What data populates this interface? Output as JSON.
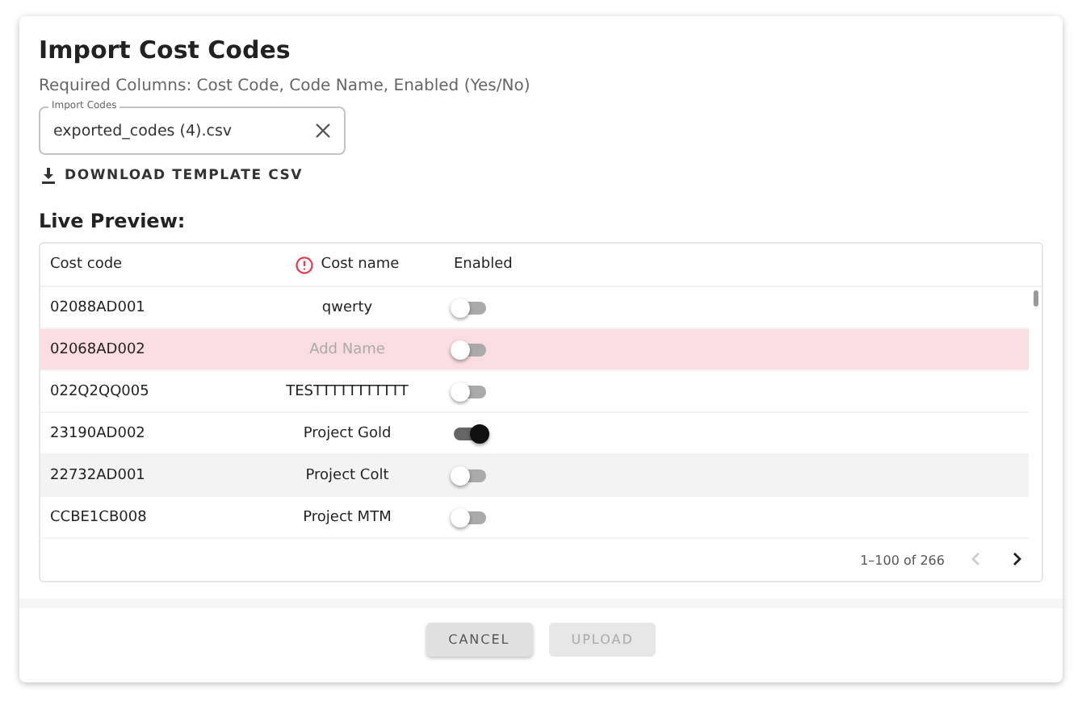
{
  "dialog": {
    "title": "Import Cost Codes",
    "subtitle": "Required Columns: Cost Code, Code Name, Enabled (Yes/No)"
  },
  "file_field": {
    "label": "Import Codes",
    "value": "exported_codes (4).csv"
  },
  "download_button": {
    "label": "DOWNLOAD TEMPLATE CSV"
  },
  "preview": {
    "title": "Live Preview:"
  },
  "table": {
    "columns": [
      {
        "label": "Cost code",
        "error": false
      },
      {
        "label": "Cost name",
        "error": true
      },
      {
        "label": "Enabled",
        "error": false
      }
    ],
    "rows": [
      {
        "code": "02088AD001",
        "name": "qwerty",
        "name_missing": false,
        "enabled": false,
        "error": false,
        "hovered": false
      },
      {
        "code": "02068AD002",
        "name": "Add Name",
        "name_missing": true,
        "enabled": false,
        "error": true,
        "hovered": false
      },
      {
        "code": "022Q2QQ005",
        "name": "TESTTTTTTTTTTT",
        "name_missing": false,
        "enabled": false,
        "error": false,
        "hovered": false
      },
      {
        "code": "23190AD002",
        "name": "Project Gold",
        "name_missing": false,
        "enabled": true,
        "error": false,
        "hovered": false
      },
      {
        "code": "22732AD001",
        "name": "Project Colt",
        "name_missing": false,
        "enabled": false,
        "error": false,
        "hovered": true
      },
      {
        "code": "CCBE1CB008",
        "name": "Project MTM",
        "name_missing": false,
        "enabled": false,
        "error": false,
        "hovered": false
      }
    ],
    "pagination": {
      "range": "1–100 of 266",
      "prev_disabled": true,
      "next_disabled": false
    }
  },
  "buttons": [
    {
      "label": "CANCEL",
      "disabled": false
    },
    {
      "label": "UPLOAD",
      "disabled": true
    }
  ]
}
